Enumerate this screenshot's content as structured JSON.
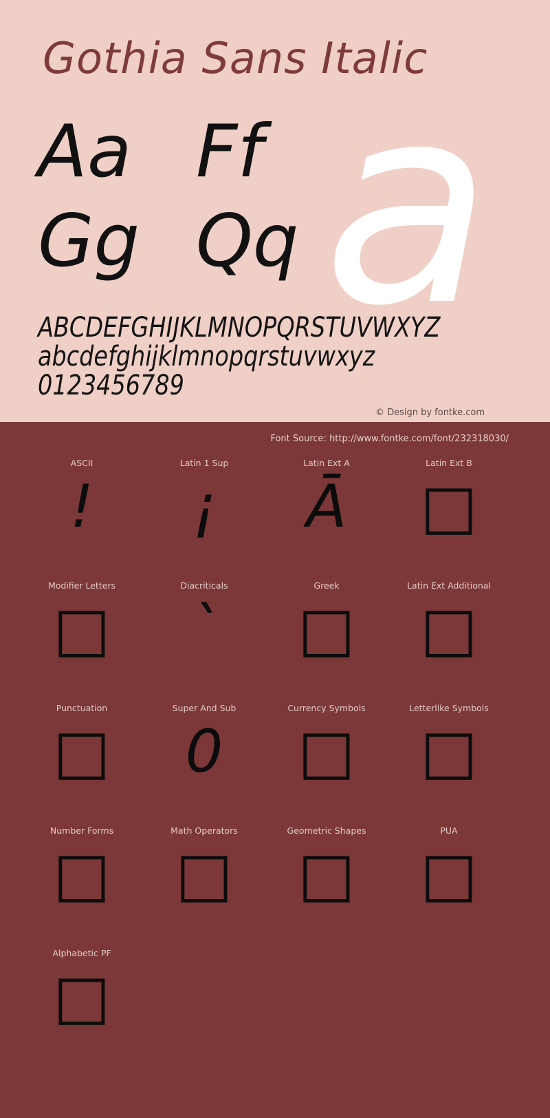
{
  "specimen": {
    "font_title": "Gothia Sans Italic",
    "watermark_glyph": "a",
    "letter_pairs": [
      [
        "Aa",
        "Ff"
      ],
      [
        "Gg",
        "Qq"
      ]
    ],
    "uppercase": "ABCDEFGHIJKLMNOPQRSTUVWXYZ",
    "lowercase": "abcdefghijklmnopqrstuvwxyz",
    "digits": "0123456789",
    "copyright": "© Design by fontke.com",
    "font_source": "Font Source: http://www.fontke.com/font/232318030/",
    "colors": {
      "panel_light": "#f0cfc6",
      "panel_dark": "#7c3838",
      "title": "#7e3b3b",
      "glyph": "#111111",
      "watermark": "#ffffff",
      "label": "#e3c9c5"
    }
  },
  "unicode_blocks": {
    "rows": [
      [
        {
          "label": "ASCII",
          "glyph": "!"
        },
        {
          "label": "Latin 1 Sup",
          "glyph": "¡"
        },
        {
          "label": "Latin Ext A",
          "glyph": "Ā"
        },
        {
          "label": "Latin Ext B",
          "glyph": "□"
        }
      ],
      [
        {
          "label": "Modifier Letters",
          "glyph": "□"
        },
        {
          "label": "Diacriticals",
          "glyph": "`"
        },
        {
          "label": "Greek",
          "glyph": "□"
        },
        {
          "label": "Latin Ext Additional",
          "glyph": "□"
        }
      ],
      [
        {
          "label": "Punctuation",
          "glyph": "□"
        },
        {
          "label": "Super And Sub",
          "glyph": "0"
        },
        {
          "label": "Currency Symbols",
          "glyph": "□"
        },
        {
          "label": "Letterlike Symbols",
          "glyph": "□"
        }
      ],
      [
        {
          "label": "Number Forms",
          "glyph": "□"
        },
        {
          "label": "Math Operators",
          "glyph": "□"
        },
        {
          "label": "Geometric Shapes",
          "glyph": "□"
        },
        {
          "label": "PUA",
          "glyph": "□"
        }
      ],
      [
        {
          "label": "Alphabetic PF",
          "glyph": "□"
        },
        {
          "label": "",
          "glyph": ""
        },
        {
          "label": "",
          "glyph": ""
        },
        {
          "label": "",
          "glyph": ""
        }
      ]
    ]
  }
}
